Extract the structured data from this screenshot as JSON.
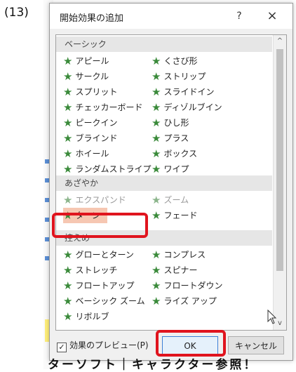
{
  "step_label": "(13)",
  "dialog": {
    "title": "開始効果の追加",
    "help_label": "?",
    "close_label": "×"
  },
  "categories": [
    {
      "label": "ベーシック"
    },
    {
      "label": "あざやか"
    },
    {
      "label": "控えめ"
    }
  ],
  "effects": {
    "basic": [
      "アピール",
      "くさび形",
      "サークル",
      "ストリップ",
      "スプリット",
      "スライドイン",
      "チェッカーボード",
      "ディゾルブイン",
      "ピークイン",
      "ひし形",
      "ブラインド",
      "プラス",
      "ホイール",
      "ボックス",
      "ランダムストライプ",
      "ワイプ"
    ],
    "exciting": [
      "エクスパンド",
      "ズーム",
      "ターン",
      "フェード"
    ],
    "subtle": [
      "グローとターン",
      "コンプレス",
      "ストレッチ",
      "スピナー",
      "フロートアップ",
      "フロートダウン",
      "ベーシック ズーム",
      "ライズ アップ",
      "リボルブ"
    ],
    "star": "★",
    "selected": "ターン"
  },
  "scroll": {
    "up": "^",
    "down": "v"
  },
  "preview": {
    "checkbox_mark": "☑",
    "label": "効果のプレビュー(P)"
  },
  "buttons": {
    "ok": "OK",
    "cancel": "キャンセル"
  },
  "colors": {
    "highlight_box": "#e0141e",
    "selected_bg": "#f6c7b2",
    "star": "#3a8a3a"
  },
  "background_text": {
    "bottom": "ターソフト｜キャラクター参照！"
  }
}
